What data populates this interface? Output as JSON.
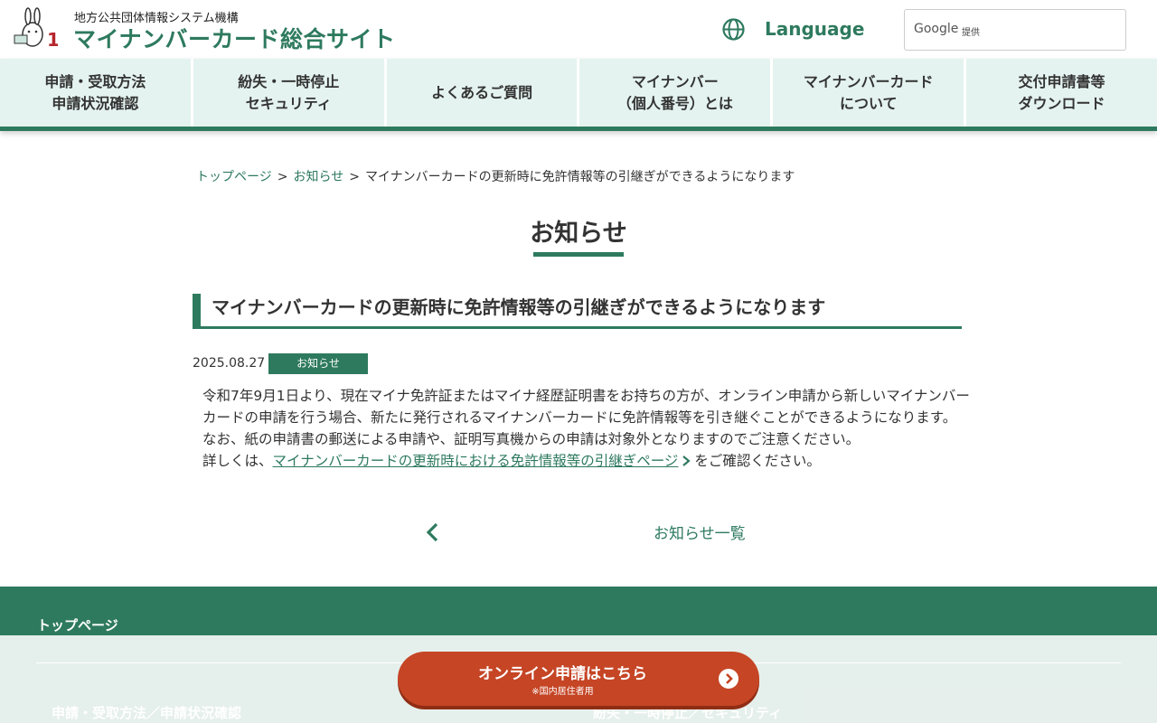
{
  "header": {
    "org_name": "地方公共団体情報システム機構",
    "site_title": "マイナンバーカード総合サイト",
    "language_label": "Language",
    "translate_brand": "Google",
    "translate_provided": "提供"
  },
  "nav": {
    "items": [
      {
        "label": "申請・受取方法\n申請状況確認"
      },
      {
        "label": "紛失・一時停止\nセキュリティ"
      },
      {
        "label": "よくあるご質問"
      },
      {
        "label": "マイナンバー\n（個人番号）とは"
      },
      {
        "label": "マイナンバーカード\nについて"
      },
      {
        "label": "交付申請書等\nダウンロード"
      }
    ]
  },
  "breadcrumb": {
    "items": [
      "トップページ",
      "お知らせ",
      "マイナンバーカードの更新時に免許情報等の引継ぎができるようになります"
    ],
    "separator": ">"
  },
  "page": {
    "title": "お知らせ"
  },
  "article": {
    "heading": "マイナンバーカードの更新時に免許情報等の引継ぎができるようになります",
    "date": "2025.08.27",
    "category": "お知らせ",
    "paragraph_1": "令和7年9月1日より、現在マイナ免許証またはマイナ経歴証明書をお持ちの方が、オンライン申請から新しいマイナンバーカードの申請を行う場合、新たに発行されるマイナンバーカードに免許情報等を引き継ぐことができるようになります。",
    "paragraph_2": "なお、紙の申請書の郵送による申請や、証明写真機からの申請は対象外となりますのでご注意ください。",
    "detail_prefix": "詳しくは、",
    "detail_link": "マイナンバーカードの更新時における免許情報等の引継ぎページ",
    "detail_suffix": "をご確認ください。"
  },
  "pager": {
    "list_label": "お知らせ一覧"
  },
  "footer": {
    "top_link": "トップページ",
    "col1_heading": "申請・受取方法／申請状況確認",
    "col2_heading": "紛失・一時停止／セキュリティ"
  },
  "cta": {
    "main": "オンライン申請はこちら",
    "sub": "※国内居住者用"
  },
  "colors": {
    "brand_green": "#2e7a5f",
    "nav_bg": "#e4f3ef",
    "cta_red": "#c54525"
  }
}
